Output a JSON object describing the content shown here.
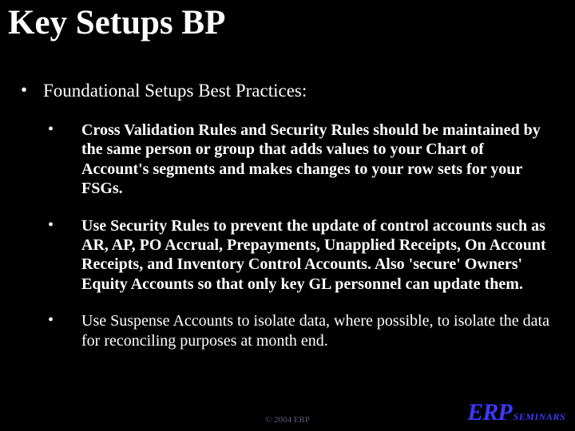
{
  "title": "Key Setups BP",
  "l1": {
    "bullet": "•",
    "text": "Foundational Setups Best Practices:"
  },
  "l2": [
    {
      "bullet": "•",
      "text": "Cross Validation Rules and Security Rules should be maintained by the same person or group that adds values to your Chart of Account's segments and makes changes to your row sets for your FSGs.",
      "bold": true
    },
    {
      "bullet": "•",
      "text": "Use Security Rules to prevent the update of control accounts such as AR, AP, PO Accrual, Prepayments, Unapplied Receipts, On Account Receipts, and Inventory Control Accounts.  Also 'secure' Owners' Equity Accounts so that only key GL personnel can update them.",
      "bold": true
    },
    {
      "bullet": "•",
      "text": "Use Suspense Accounts to isolate data, where possible, to isolate the data for reconciling purposes at month end.",
      "bold": false
    }
  ],
  "footer": {
    "copyright": "© 2004 ERP",
    "logo_main": "ERP",
    "logo_sub": "SEMINARS"
  }
}
